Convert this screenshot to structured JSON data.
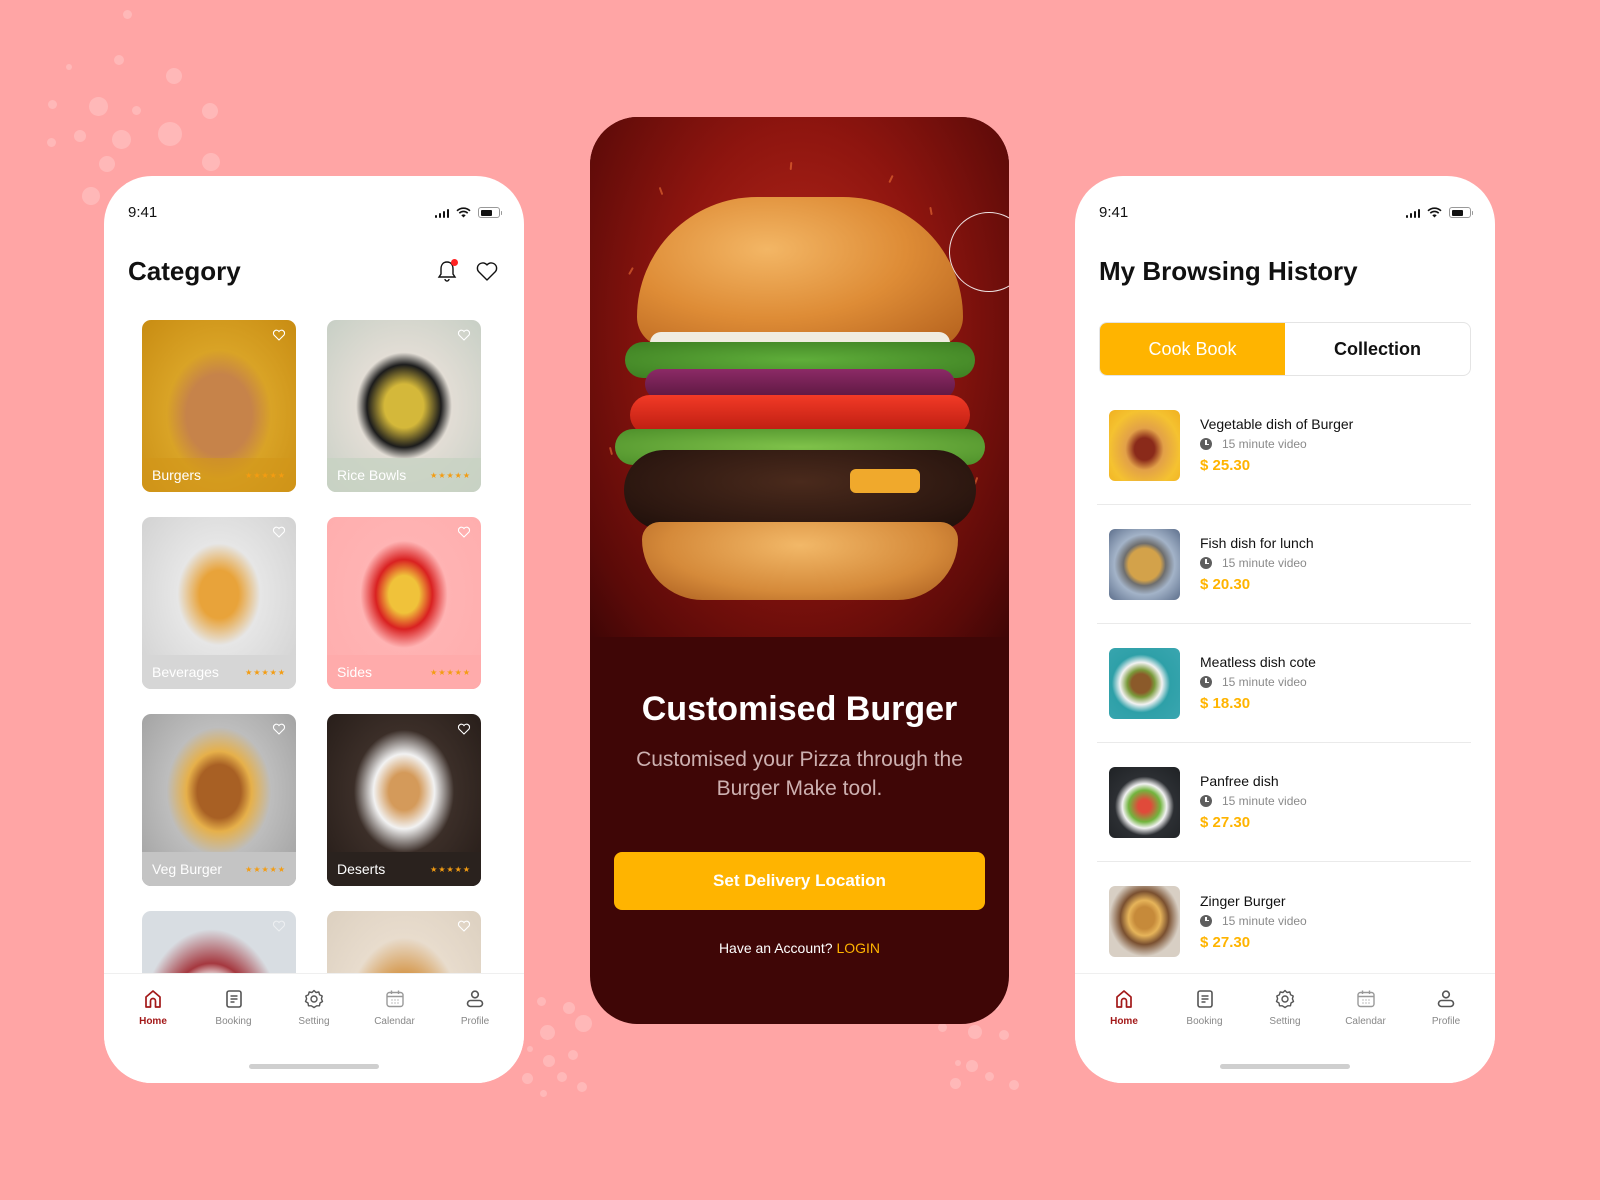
{
  "colors": {
    "background": "#FFA5A5",
    "accent": "#FFB400",
    "active_nav": "#A31919",
    "hero_dark": "#3F0606",
    "star": "#F39C12",
    "notification_dot": "#FF2222"
  },
  "left_phone": {
    "status": {
      "time": "9:41"
    },
    "title": "Category",
    "header_icons": [
      "bell-icon",
      "heart-icon"
    ],
    "categories": [
      {
        "label": "Burgers",
        "rating_stars": "★★★★★",
        "rating": 5
      },
      {
        "label": "Rice Bowls",
        "rating_stars": "★★★★★",
        "rating": 5
      },
      {
        "label": "Beverages",
        "rating_stars": "★★★★★",
        "rating": 5
      },
      {
        "label": "Sides",
        "rating_stars": "★★★★★",
        "rating": 5
      },
      {
        "label": "Veg Burger",
        "rating_stars": "★★★★★",
        "rating": 5
      },
      {
        "label": "Deserts",
        "rating_stars": "★★★★★",
        "rating": 5
      }
    ],
    "nav": [
      {
        "label": "Home",
        "icon": "home-icon",
        "active": true
      },
      {
        "label": "Booking",
        "icon": "booking-icon",
        "active": false
      },
      {
        "label": "Setting",
        "icon": "gear-icon",
        "active": false
      },
      {
        "label": "Calendar",
        "icon": "calendar-icon",
        "active": false
      },
      {
        "label": "Profile",
        "icon": "profile-icon",
        "active": false
      }
    ]
  },
  "middle_phone": {
    "title": "Customised Burger",
    "subtitle": "Customised your Pizza through the Burger Make tool.",
    "cta_label": "Set Delivery Location",
    "login_prompt": "Have an Account?",
    "login_link": "LOGIN"
  },
  "right_phone": {
    "status": {
      "time": "9:41"
    },
    "title": "My Browsing History",
    "tabs": [
      {
        "label": "Cook Book",
        "active": true
      },
      {
        "label": "Collection",
        "active": false
      }
    ],
    "history": [
      {
        "title": "Vegetable dish of Burger",
        "meta": "15 minute video",
        "price": "$ 25.30"
      },
      {
        "title": "Fish dish for lunch",
        "meta": "15 minute video",
        "price": "$ 20.30"
      },
      {
        "title": "Meatless dish cote",
        "meta": "15 minute video",
        "price": "$ 18.30"
      },
      {
        "title": "Panfree dish",
        "meta": "15 minute video",
        "price": "$ 27.30"
      },
      {
        "title": "Zinger Burger",
        "meta": "15 minute video",
        "price": "$ 27.30"
      }
    ],
    "nav": [
      {
        "label": "Home",
        "icon": "home-icon",
        "active": true
      },
      {
        "label": "Booking",
        "icon": "booking-icon",
        "active": false
      },
      {
        "label": "Setting",
        "icon": "gear-icon",
        "active": false
      },
      {
        "label": "Calendar",
        "icon": "calendar-icon",
        "active": false
      },
      {
        "label": "Profile",
        "icon": "profile-icon",
        "active": false
      }
    ]
  }
}
